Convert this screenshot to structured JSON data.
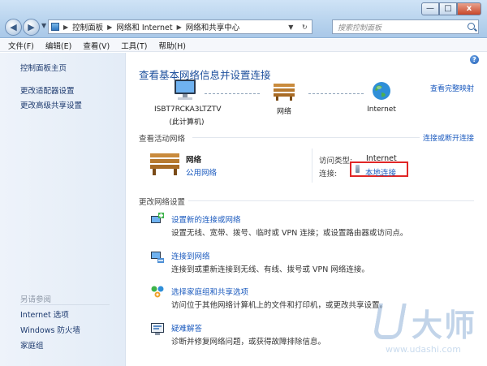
{
  "window": {
    "breadcrumb": [
      "控制面板",
      "网络和 Internet",
      "网络和共享中心"
    ],
    "search_placeholder": "搜索控制面板",
    "controls": {
      "minimize": "—",
      "maximize": "□",
      "close": "x"
    }
  },
  "menu": [
    "文件(F)",
    "编辑(E)",
    "查看(V)",
    "工具(T)",
    "帮助(H)"
  ],
  "left_pane": {
    "links": [
      "控制面板主页",
      "更改适配器设置",
      "更改高级共享设置"
    ],
    "see_also_title": "另请参阅",
    "see_also": [
      "Internet 选项",
      "Windows 防火墙",
      "家庭组"
    ]
  },
  "main": {
    "title": "查看基本网络信息并设置连接",
    "full_map_link": "查看完整映射",
    "map_nodes": [
      {
        "name": "ISBT7RCKA3LTZTV",
        "sub": "(此计算机)"
      },
      {
        "name": "网络",
        "sub": ""
      },
      {
        "name": "Internet",
        "sub": ""
      }
    ],
    "active_networks": {
      "heading": "查看活动网络",
      "connect_link": "连接或断开连接",
      "network_name": "网络",
      "network_type": "公用网络",
      "access_type_label": "访问类型:",
      "access_type_value": "Internet",
      "connection_label": "连接:",
      "connection_value": "本地连接"
    },
    "change_settings": {
      "heading": "更改网络设置",
      "tasks": [
        {
          "link": "设置新的连接或网络",
          "desc": "设置无线、宽带、拨号、临时或 VPN 连接；或设置路由器或访问点。"
        },
        {
          "link": "连接到网络",
          "desc": "连接到或重新连接到无线、有线、拨号或 VPN 网络连接。"
        },
        {
          "link": "选择家庭组和共享选项",
          "desc": "访问位于其他网络计算机上的文件和打印机，或更改共享设置。"
        },
        {
          "link": "疑难解答",
          "desc": "诊断并修复网络问题，或获得故障排除信息。"
        }
      ]
    }
  },
  "watermark": {
    "text": "大师",
    "url": "www.udashi.com"
  },
  "colors": {
    "link": "#1c5bbf",
    "title": "#1c4f9c",
    "highlight_box": "#e02626"
  }
}
